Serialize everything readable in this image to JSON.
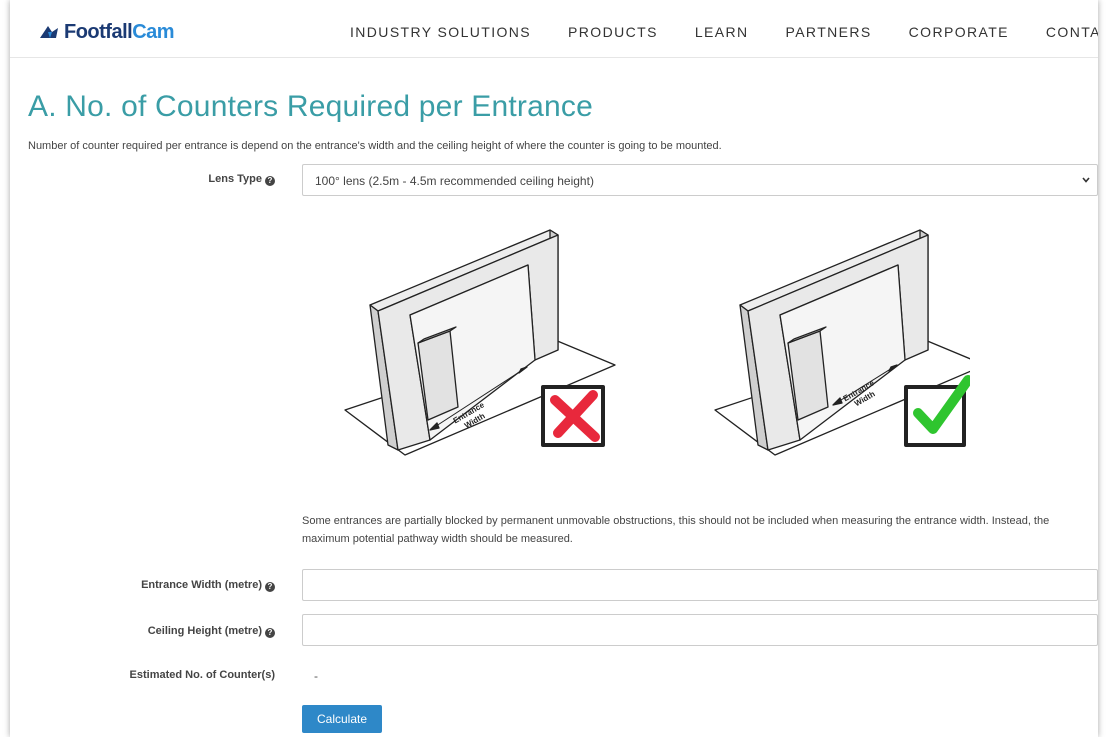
{
  "header": {
    "logo_main": "Footfall",
    "logo_accent": "Cam",
    "nav": [
      "INDUSTRY SOLUTIONS",
      "PRODUCTS",
      "LEARN",
      "PARTNERS",
      "CORPORATE",
      "CONTACT US"
    ]
  },
  "page": {
    "title": "A. No. of Counters Required per Entrance",
    "description": "Number of counter required per entrance is depend on the entrance's width and the ceiling height of where the counter is going to be mounted."
  },
  "form": {
    "lens_type_label": "Lens Type",
    "lens_type_value": "100° lens (2.5m - 4.5m recommended ceiling height)",
    "illustration_label_1": "Entrance",
    "illustration_label_2": "Width",
    "note": "Some entrances are partially blocked by permanent unmovable obstructions, this should not be included when measuring the entrance width. Instead, the maximum potential pathway width should be measured.",
    "entrance_width_label": "Entrance Width (metre)",
    "entrance_width_value": "",
    "ceiling_height_label": "Ceiling Height (metre)",
    "ceiling_height_value": "",
    "estimated_label": "Estimated No. of Counter(s)",
    "estimated_value": "-",
    "calculate_label": "Calculate"
  },
  "colors": {
    "title": "#3a9da6",
    "button": "#2e88c8",
    "cross": "#e8283c",
    "check": "#2fc52f"
  },
  "icons": {
    "help": "question-circle-icon",
    "dropdown": "chevron-down-icon"
  }
}
